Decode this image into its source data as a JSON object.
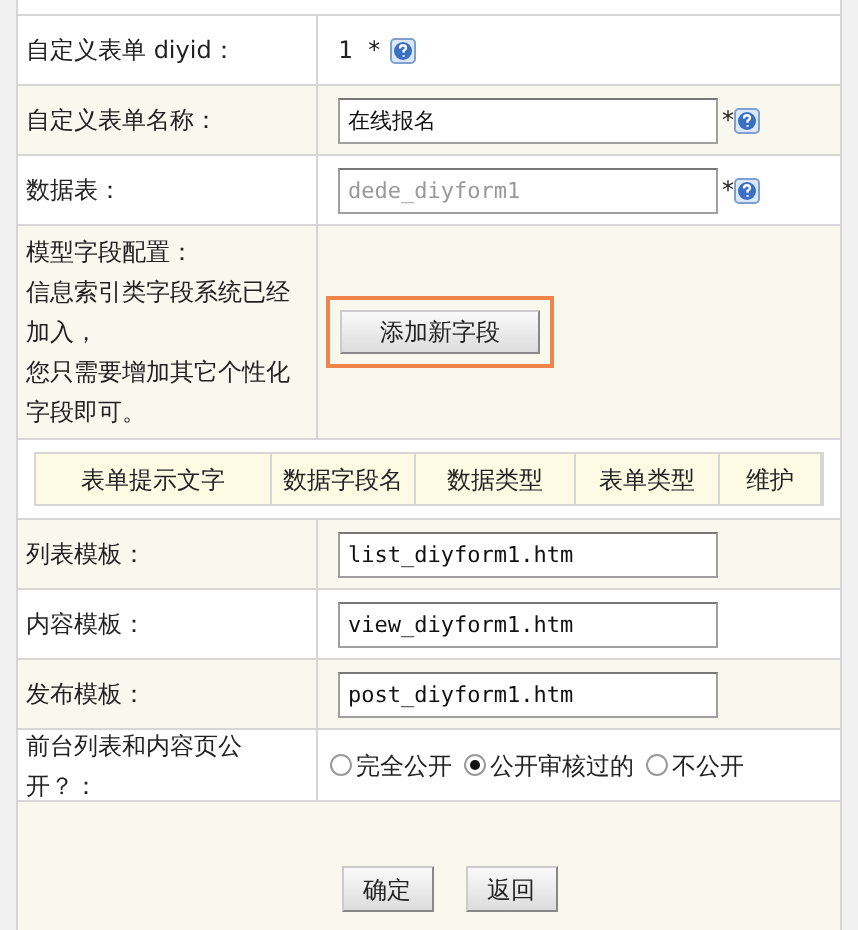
{
  "rows": [
    {
      "kind": "static",
      "label": "自定义表单 diyid：",
      "value": "1 *",
      "help": true
    },
    {
      "kind": "input",
      "label": "自定义表单名称：",
      "value": "在线报名",
      "disabled": false,
      "required": "*",
      "help": true
    },
    {
      "kind": "input",
      "label": "数据表：",
      "value": "dede_diyform1",
      "disabled": true,
      "required": "*",
      "help": true
    },
    {
      "kind": "fields",
      "label_lines": [
        "模型字段配置：",
        "信息索引类字段系统已经加入，",
        "您只需要增加其它个性化字段即可。"
      ],
      "button": "添加新字段",
      "highlighted": true
    },
    {
      "kind": "table",
      "columns": [
        "表单提示文字",
        "数据字段名",
        "数据类型",
        "表单类型",
        "维护"
      ]
    },
    {
      "kind": "input",
      "label": "列表模板：",
      "value": "list_diyform1.htm",
      "disabled": false
    },
    {
      "kind": "input",
      "label": "内容模板：",
      "value": "view_diyform1.htm",
      "disabled": false
    },
    {
      "kind": "input",
      "label": "发布模板：",
      "value": "post_diyform1.htm",
      "disabled": false
    },
    {
      "kind": "radio",
      "label": "前台列表和内容页公开？：",
      "options": [
        {
          "label": "完全公开",
          "selected": false
        },
        {
          "label": "公开审核过的",
          "selected": true
        },
        {
          "label": "不公开",
          "selected": false
        }
      ]
    },
    {
      "kind": "buttons",
      "buttons": [
        "确定",
        "返回"
      ]
    }
  ]
}
